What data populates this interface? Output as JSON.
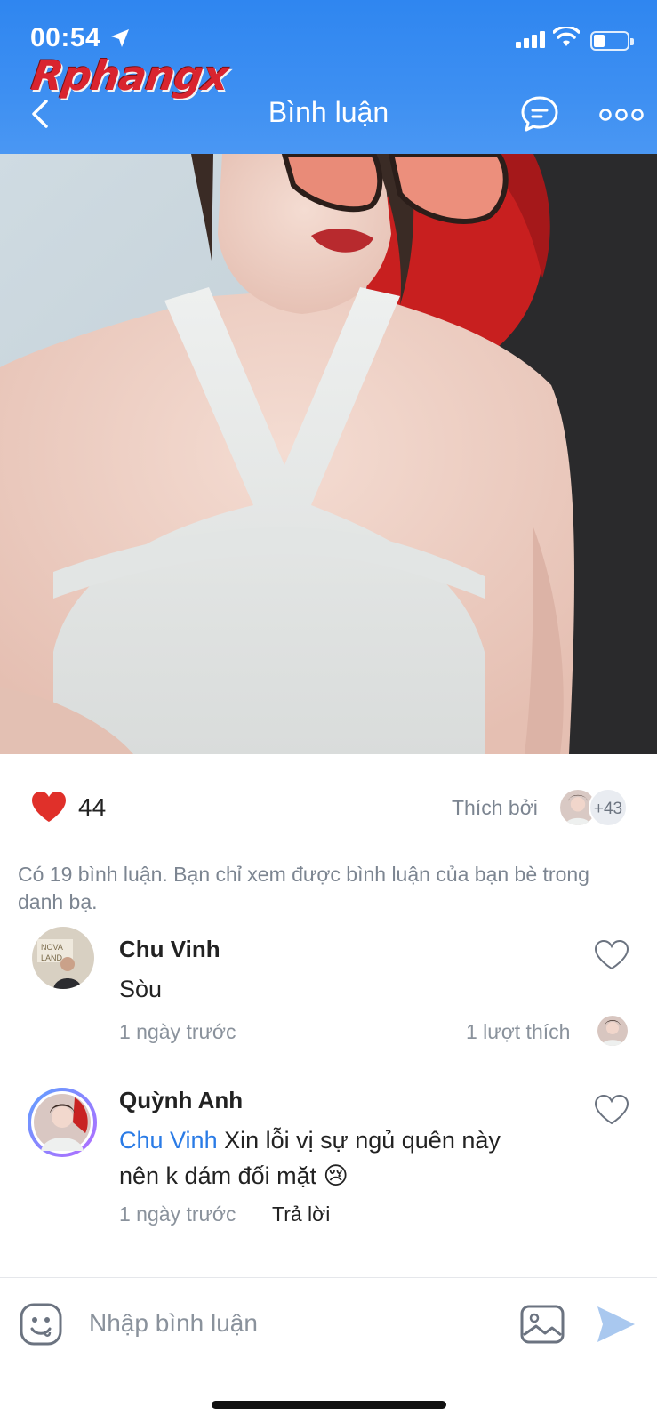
{
  "status_bar": {
    "time": "00:54"
  },
  "watermark": {
    "brand": "Rphangx"
  },
  "header": {
    "title": "Bình luận"
  },
  "post": {
    "like_count": "44",
    "liked_by_label": "Thích bởi",
    "liked_by_more": "+43",
    "comment_notice": "Có 19 bình luận. Bạn chỉ xem được bình luận của bạn bè trong danh bạ."
  },
  "comments": [
    {
      "author": "Chu Vinh",
      "text": "Sòu",
      "time": "1 ngày trước",
      "likes": "1 lượt thích"
    },
    {
      "author": "Quỳnh Anh",
      "mention": "Chu Vinh",
      "text": "Xin lỗi vị sự ngủ quên này nên k dám đối mặt 😢",
      "time": "1 ngày trước",
      "reply_label": "Trả lời"
    }
  ],
  "composer": {
    "placeholder": "Nhập bình luận"
  },
  "colors": {
    "header_blue": "#2f86f0",
    "heart_red": "#e0302a",
    "mention_blue": "#2a7be6",
    "muted_gray": "#7c8591"
  },
  "icons": [
    "location-arrow-icon",
    "signal-icon",
    "wifi-icon",
    "battery-icon",
    "back-chevron-icon",
    "chat-bubble-icon",
    "more-dots-icon",
    "heart-filled-icon",
    "heart-outline-icon",
    "emoji-icon",
    "image-icon",
    "send-icon"
  ]
}
